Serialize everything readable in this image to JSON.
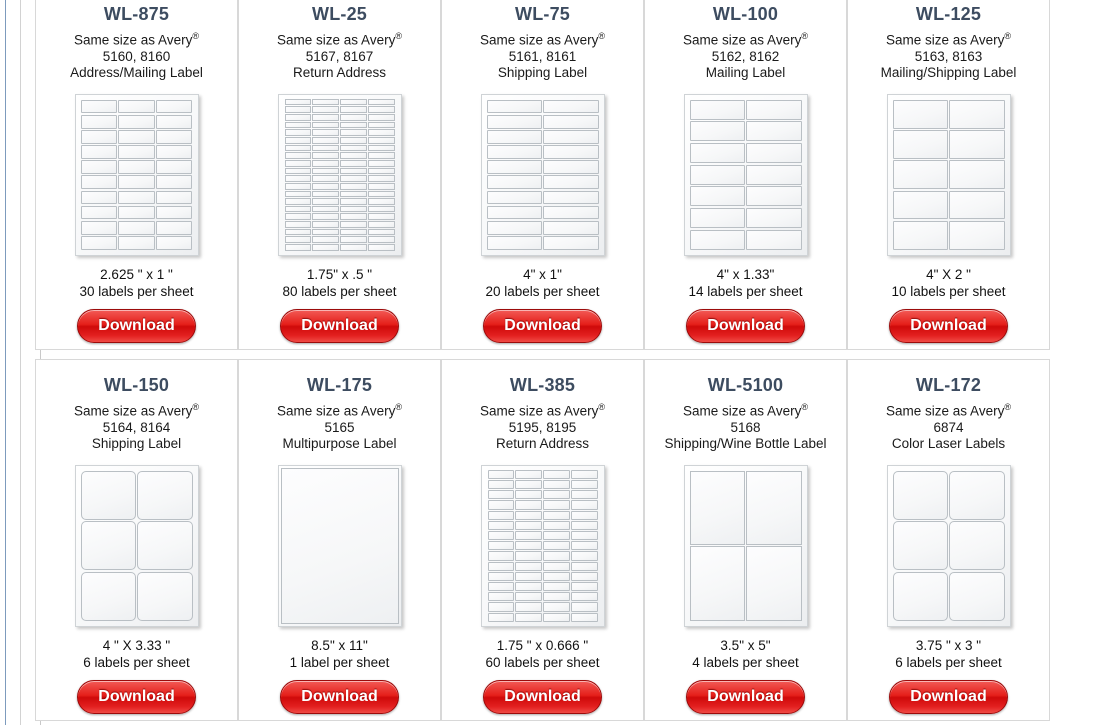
{
  "page": {
    "download_label": "Download",
    "avery_prefix": "Same size as Avery",
    "registered_mark": "®"
  },
  "products": [
    {
      "sku": "WL-875",
      "avery_line": "Same size as Avery®",
      "avery_codes": "5160, 8160",
      "label_type": "Address/Mailing Label",
      "dimensions": "2.625 \" x 1 \"",
      "per_sheet": "30 labels per sheet",
      "download_label": "Download",
      "sheet": {
        "cols": 3,
        "rows": 10,
        "radius": "r-sm"
      }
    },
    {
      "sku": "WL-25",
      "avery_line": "Same size as Avery®",
      "avery_codes": "5167, 8167",
      "label_type": "Return Address",
      "dimensions": "1.75\" x .5 \"",
      "per_sheet": "80 labels per sheet",
      "download_label": "Download",
      "sheet": {
        "cols": 4,
        "rows": 20,
        "radius": "r-none"
      }
    },
    {
      "sku": "WL-75",
      "avery_line": "Same size as Avery®",
      "avery_codes": "5161, 8161",
      "label_type": "Shipping Label",
      "dimensions": "4\" x 1\"",
      "per_sheet": "20 labels per sheet",
      "download_label": "Download",
      "sheet": {
        "cols": 2,
        "rows": 10,
        "radius": "r-sm"
      }
    },
    {
      "sku": "WL-100",
      "avery_line": "Same size as Avery®",
      "avery_codes": "5162, 8162",
      "label_type": "Mailing Label",
      "dimensions": "4\" x 1.33\"",
      "per_sheet": "14 labels per sheet",
      "download_label": "Download",
      "sheet": {
        "cols": 2,
        "rows": 7,
        "radius": "r-sm"
      }
    },
    {
      "sku": "WL-125",
      "avery_line": "Same size as Avery®",
      "avery_codes": "5163, 8163",
      "label_type": "Mailing/Shipping Label",
      "dimensions": "4\" X 2 \"",
      "per_sheet": "10 labels per sheet",
      "download_label": "Download",
      "sheet": {
        "cols": 2,
        "rows": 5,
        "radius": "r-sm"
      }
    },
    {
      "sku": "WL-150",
      "avery_line": "Same size as Avery®",
      "avery_codes": "5164, 8164",
      "label_type": "Shipping Label",
      "dimensions": "4 \" X 3.33 \"",
      "per_sheet": "6 labels per sheet",
      "download_label": "Download",
      "sheet": {
        "cols": 2,
        "rows": 3,
        "radius": "r-lg"
      }
    },
    {
      "sku": "WL-175",
      "avery_line": "Same size as Avery®",
      "avery_codes": "5165",
      "label_type": "Multipurpose Label",
      "dimensions": "8.5\" x 11\"",
      "per_sheet": "1 label per sheet",
      "download_label": "Download",
      "sheet": {
        "cols": 1,
        "rows": 1,
        "radius": "r-none"
      }
    },
    {
      "sku": "WL-385",
      "avery_line": "Same size as Avery®",
      "avery_codes": "5195, 8195",
      "label_type": "Return Address",
      "dimensions": "1.75 \" x 0.666 \"",
      "per_sheet": "60 labels per sheet",
      "download_label": "Download",
      "sheet": {
        "cols": 4,
        "rows": 15,
        "radius": "r-sm"
      }
    },
    {
      "sku": "WL-5100",
      "avery_line": "Same size as Avery®",
      "avery_codes": "5168",
      "label_type": "Shipping/Wine Bottle Label",
      "dimensions": "3.5\" x 5\"",
      "per_sheet": "4 labels per sheet",
      "download_label": "Download",
      "sheet": {
        "cols": 2,
        "rows": 2,
        "radius": "r-none"
      }
    },
    {
      "sku": "WL-172",
      "avery_line": "Same size as Avery®",
      "avery_codes": "6874",
      "label_type": "Color Laser Labels",
      "dimensions": "3.75 \" x 3 \"",
      "per_sheet": "6 labels per sheet",
      "download_label": "Download",
      "sheet": {
        "cols": 2,
        "rows": 3,
        "radius": "r-lg"
      }
    }
  ]
}
